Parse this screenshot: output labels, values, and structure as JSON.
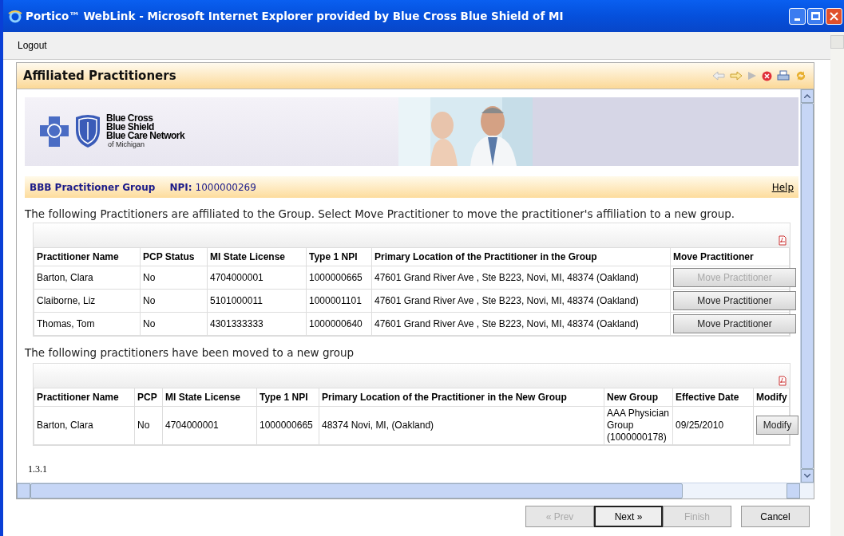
{
  "window": {
    "title": "Portico™ WebLink - Microsoft Internet Explorer provided by Blue Cross Blue Shield of MI"
  },
  "menu": [
    {
      "label": "Logout"
    }
  ],
  "panel": {
    "title": "Affiliated Practitioners"
  },
  "banner": {
    "logo_lines": [
      "Blue Cross",
      "Blue Shield",
      "Blue Care Network"
    ],
    "logo_subline": "of Michigan"
  },
  "group": {
    "name": "BBB Practitioner Group",
    "npi_label": "NPI:",
    "npi_value": "1000000269",
    "help": "Help"
  },
  "affiliated": {
    "intro": "The following Practitioners are affiliated to the Group. Select Move Practitioner to move the practitioner's affiliation to a new group.",
    "columns": [
      "Practitioner Name",
      "PCP Status",
      "MI State License",
      "Type 1 NPI",
      "Primary Location of the Practitioner in the Group",
      "Move Practitioner"
    ],
    "rows": [
      {
        "cells": [
          "Barton, Clara",
          "No",
          "4704000001",
          "1000000665",
          "47601 Grand River Ave , Ste B223, Novi, MI, 48374 (Oakland)"
        ],
        "button": {
          "label": "Move Practitioner",
          "disabled": true
        }
      },
      {
        "cells": [
          "Claiborne, Liz",
          "No",
          "5101000011",
          "1000001101",
          "47601 Grand River Ave , Ste B223, Novi, MI, 48374 (Oakland)"
        ],
        "button": {
          "label": "Move Practitioner",
          "disabled": false
        }
      },
      {
        "cells": [
          "Thomas, Tom",
          "No",
          "4301333333",
          "1000000640",
          "47601 Grand River Ave , Ste B223, Novi, MI, 48374 (Oakland)"
        ],
        "button": {
          "label": "Move Practitioner",
          "disabled": false
        }
      }
    ]
  },
  "moved": {
    "intro": "The following practitioners have been moved to a new group",
    "columns": [
      "Practitioner Name",
      "PCP",
      "MI State License",
      "Type 1 NPI",
      "Primary Location of the Practitioner in the New Group",
      "New Group",
      "Effective Date",
      "Modify"
    ],
    "rows": [
      {
        "cells": [
          "Barton, Clara",
          "No",
          "4704000001",
          "1000000665",
          "48374 Novi, MI, (Oakland)",
          "AAA Physician Group (1000000178)",
          "09/25/2010"
        ],
        "button": {
          "label": "Modify",
          "disabled": false
        }
      }
    ]
  },
  "version": "1.3.1",
  "footer_buttons": [
    {
      "label": "« Prev",
      "disabled": true,
      "default": false
    },
    {
      "label": "Next »",
      "disabled": false,
      "default": true
    },
    {
      "label": "Finish",
      "disabled": true,
      "default": false
    },
    {
      "label": "Cancel",
      "disabled": false,
      "default": false
    }
  ]
}
